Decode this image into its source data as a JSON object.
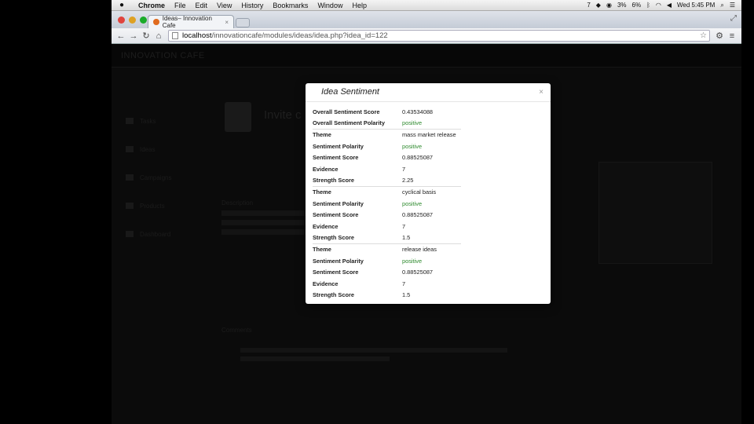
{
  "menubar": {
    "apple": "",
    "items": [
      "Chrome",
      "File",
      "Edit",
      "View",
      "History",
      "Bookmarks",
      "Window",
      "Help"
    ],
    "status": {
      "num": "7",
      "battery_a": "3%",
      "battery_b": "6%",
      "clock": "Wed 5:45 PM"
    }
  },
  "browser": {
    "tab_title": "Ideas– Innovation Cafe",
    "url_domain": "localhost",
    "url_path": "/innovationcafe/modules/ideas/idea.php?idea_id=122"
  },
  "page": {
    "brand": "INNOVATION CAFE",
    "title": "Invite c",
    "sidebar": [
      "Tasks",
      "Ideas",
      "Campaigns",
      "Products",
      "Dashboard"
    ],
    "description_label": "Description",
    "comments_label": "Comments"
  },
  "modal": {
    "title": "Idea Sentiment",
    "close": "×",
    "rows": [
      {
        "key": "Overall Sentiment Score",
        "value": "0.43534088",
        "positive": false,
        "theme": false
      },
      {
        "key": "Overall Sentiment Polarity",
        "value": "positive",
        "positive": true,
        "theme": false
      },
      {
        "key": "Theme",
        "value": "mass market release",
        "positive": false,
        "theme": true
      },
      {
        "key": "Sentiment Polarity",
        "value": "positive",
        "positive": true,
        "theme": false
      },
      {
        "key": "Sentiment Score",
        "value": "0.88525087",
        "positive": false,
        "theme": false
      },
      {
        "key": "Evidence",
        "value": "7",
        "positive": false,
        "theme": false
      },
      {
        "key": "Strength Score",
        "value": "2.25",
        "positive": false,
        "theme": false
      },
      {
        "key": "Theme",
        "value": "cyclical basis",
        "positive": false,
        "theme": true
      },
      {
        "key": "Sentiment Polarity",
        "value": "positive",
        "positive": true,
        "theme": false
      },
      {
        "key": "Sentiment Score",
        "value": "0.88525087",
        "positive": false,
        "theme": false
      },
      {
        "key": "Evidence",
        "value": "7",
        "positive": false,
        "theme": false
      },
      {
        "key": "Strength Score",
        "value": "1.5",
        "positive": false,
        "theme": false
      },
      {
        "key": "Theme",
        "value": "release ideas",
        "positive": false,
        "theme": true
      },
      {
        "key": "Sentiment Polarity",
        "value": "positive",
        "positive": true,
        "theme": false
      },
      {
        "key": "Sentiment Score",
        "value": "0.88525087",
        "positive": false,
        "theme": false
      },
      {
        "key": "Evidence",
        "value": "7",
        "positive": false,
        "theme": false
      },
      {
        "key": "Strength Score",
        "value": "1.5",
        "positive": false,
        "theme": false
      }
    ]
  },
  "colors": {
    "positive": "#2d8a2d",
    "overlay": "#0b0b0b"
  }
}
